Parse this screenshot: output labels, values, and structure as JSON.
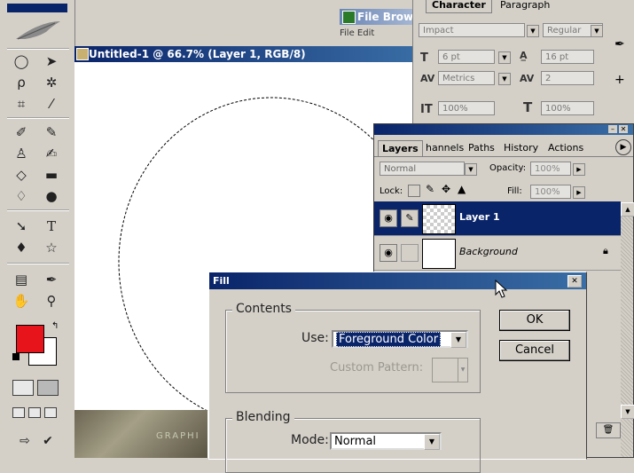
{
  "document": {
    "title": "Untitled-1 @ 66.7% (Layer 1, RGB/8)"
  },
  "file_browser": {
    "title": "File Brow",
    "menu": "File   Edit"
  },
  "character_panel": {
    "tabs": [
      "Character",
      "Paragraph"
    ],
    "font_family": "Impact",
    "font_style": "Regular",
    "font_size": "6 pt",
    "leading": "16 pt",
    "kerning": "Metrics",
    "tracking": "2",
    "vertical_scale": "100%",
    "horizontal_scale": "100%"
  },
  "layers_panel": {
    "tabs": [
      "Layers",
      "Channels",
      "Paths",
      "History",
      "Actions"
    ],
    "tab_display": [
      "Layers",
      "hannels",
      "Paths",
      "History",
      "Actions"
    ],
    "blend_mode": "Normal",
    "opacity_label": "Opacity:",
    "opacity_value": "100%",
    "lock_label": "Lock:",
    "fill_label": "Fill:",
    "fill_value": "100%",
    "layers": [
      {
        "name": "Layer 1",
        "selected": true
      },
      {
        "name": "Background",
        "selected": false,
        "locked": true
      }
    ]
  },
  "fill_dialog": {
    "title": "Fill",
    "contents_label": "Contents",
    "use_label": "Use:",
    "use_value": "Foreground Color",
    "custom_pattern_label": "Custom Pattern:",
    "ok_label": "OK",
    "cancel_label": "Cancel",
    "blending_label": "Blending",
    "mode_label": "Mode:",
    "mode_value": "Normal"
  },
  "toolbox": {
    "foreground_color": "#e8141c",
    "background_color": "#ffffff"
  },
  "banner_text": "GRAPHI"
}
